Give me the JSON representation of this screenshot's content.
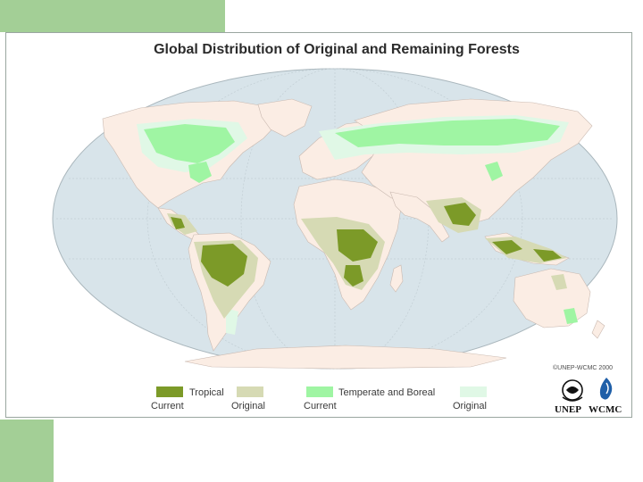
{
  "title": "Global Distribution of Original and Remaining Forests",
  "credit": "©UNEP-WCMC 2000",
  "legend": {
    "tropical_label": "Tropical",
    "temperate_label": "Temperate and Boreal",
    "current_label": "Current",
    "original_label": "Original"
  },
  "logos": {
    "unep": "UNEP",
    "wcmc": "WCMC"
  },
  "colors": {
    "tropical_current": "#7c9a28",
    "tropical_original": "#d6dab4",
    "temperate_current": "#9ff5a3",
    "temperate_original": "#e0f8e6",
    "ocean": "#d8e4ea",
    "land": "#fbede4",
    "accent_green": "#a3cf96"
  }
}
